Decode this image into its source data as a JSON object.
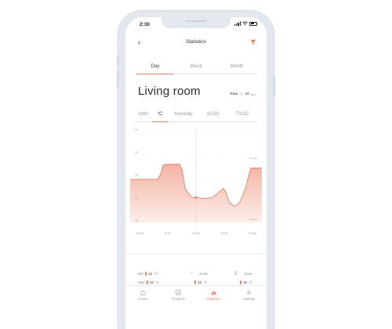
{
  "status_bar": {
    "time": "2:30"
  },
  "header": {
    "title": "Statistics",
    "back_icon": "back-arrow-icon",
    "filter_icon": "filter-icon"
  },
  "period_tabs": [
    "Day",
    "Week",
    "Month"
  ],
  "active_period": "Day",
  "room": {
    "title": "Living room",
    "total_label": "Total:",
    "total_value": "49",
    "total_unit": "kwh"
  },
  "metric_tabs": [
    "kWh",
    "°C",
    "Humidity",
    "eCO2",
    "TVOC"
  ],
  "active_metric": "°C",
  "colors": {
    "accent": "#e27f6a",
    "fill_top": "#f3b3a3",
    "fill_bottom": "#fdeeea"
  },
  "chart_data": {
    "type": "area",
    "x_labels": [
      "30 jun",
      "6:00",
      "12:00",
      "18:00",
      "31 jun"
    ],
    "y_ticks": [
      30,
      25,
      20,
      15,
      10
    ],
    "ylim": [
      10,
      30
    ],
    "annotations": {
      "high": "Too high",
      "low": "Too low"
    },
    "series": [
      {
        "x": [
          0,
          1,
          2,
          3,
          4,
          5,
          5.5,
          6,
          6.5,
          7,
          8,
          9,
          9.5,
          10,
          11,
          11.5,
          12,
          13,
          14,
          15,
          16,
          17,
          17.5,
          18,
          19,
          20,
          21,
          21.5,
          22,
          23,
          24
        ],
        "values": [
          19.5,
          19.5,
          19.5,
          19.5,
          19.5,
          19.5,
          20.5,
          22.5,
          22.8,
          22.8,
          22.8,
          22.8,
          21.5,
          17.5,
          15.8,
          15.5,
          15.5,
          15.3,
          15.3,
          15.5,
          16.5,
          17.5,
          16.5,
          14.5,
          13.5,
          14.5,
          17.5,
          19.8,
          22,
          22,
          22
        ]
      }
    ],
    "marker": {
      "x": 12,
      "y": 15.5
    },
    "cursor_x": 12
  },
  "summary": {
    "min_label": "Min",
    "max_label": "Max",
    "min_value": "12",
    "max_value": "23",
    "day_time": "11:35",
    "day_value": "15",
    "night_label": "Now",
    "night_value": "16",
    "unit": "°C"
  },
  "nav": [
    {
      "label": "House",
      "icon": "house-icon"
    },
    {
      "label": "Progress",
      "icon": "progress-icon"
    },
    {
      "label": "Statistics",
      "icon": "statistics-icon"
    },
    {
      "label": "Settings",
      "icon": "settings-icon"
    }
  ],
  "active_nav": "Statistics"
}
